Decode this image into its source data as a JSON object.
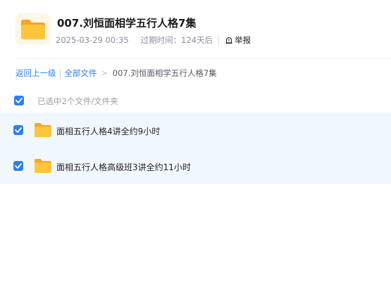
{
  "header": {
    "title": "007.刘恒面相学五行人格7集",
    "date": "2025-03-29 00:35",
    "expire_label": "过期时间：",
    "expire_value": "124天后",
    "report_label": "举报",
    "icon": "folder-icon"
  },
  "breadcrumb": {
    "back": "返回上一级",
    "separator": "|",
    "all_files": "全部文件",
    "arrow": ">",
    "current": "007.刘恒面相学五行人格7集"
  },
  "selection": {
    "text": "已选中2个文件/文件夹",
    "checked": true
  },
  "files": [
    {
      "name": "面相五行人格4讲全约9小时",
      "checked": true,
      "icon": "folder-icon"
    },
    {
      "name": "面相五行人格高级班3讲全约11小时",
      "checked": true,
      "icon": "folder-icon"
    }
  ],
  "colors": {
    "accent": "#2f7ef5",
    "folder": "#ffc53d",
    "list_bg": "#f2f8ff"
  }
}
